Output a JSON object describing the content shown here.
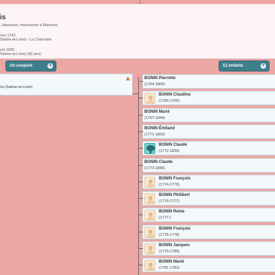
{
  "person": {
    "name_fragment": "is",
    "occupation_line": ", laboureur, manouvrier à Marcens",
    "birth_line": "nov 1742",
    "birth_place_line": "Saône-et-Loire) - La Charnotte",
    "death_line": "oct 1826",
    "death_place_line": "Saône-et-Loire) (82 ans)"
  },
  "spouses": {
    "button_label": "Un conjoint",
    "place_fragment": "ns (Saône-et-Loire)"
  },
  "children": {
    "button_label": "12 enfants",
    "items": [
      {
        "name": "BONIN Pierrette",
        "dates": "(1764-1800)",
        "avatar": "none"
      },
      {
        "name": "BONIN Claudine",
        "dates": "(1766-1766)",
        "avatar": "baby"
      },
      {
        "name": "BONIN Marié",
        "dates": "(1767-1844)",
        "avatar": "none"
      },
      {
        "name": "BONIN Émiland",
        "dates": "(1771-1826)",
        "avatar": "none"
      },
      {
        "name": "BONIN Claude",
        "dates": "(1772-1839)",
        "avatar": "tree"
      },
      {
        "name": "BONIN Claude",
        "dates": "(1773-1846)",
        "avatar": "none"
      },
      {
        "name": "BONIN François",
        "dates": "(1774-1776)",
        "avatar": "baby"
      },
      {
        "name": "BONIN Philibert",
        "dates": "(1776-1777)",
        "avatar": "baby"
      },
      {
        "name": "BONIN Reine",
        "dates": "(1777-)",
        "avatar": "baby"
      },
      {
        "name": "BONIN François",
        "dates": "(1778-1778)",
        "avatar": "baby"
      },
      {
        "name": "BONIN Jacques",
        "dates": "(1779-1789)",
        "avatar": "baby"
      },
      {
        "name": "BONIN Marié",
        "dates": "(1781-1783)",
        "avatar": "baby"
      }
    ]
  },
  "colors": {
    "background": "#eca7a5",
    "button": "#3d7e8a",
    "card": "#f3f8fa"
  }
}
